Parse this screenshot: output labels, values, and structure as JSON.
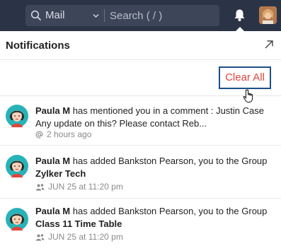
{
  "topbar": {
    "search_scope": "Mail",
    "search_placeholder": "Search ( / )"
  },
  "panel": {
    "title": "Notifications",
    "clear_all_label": "Clear All"
  },
  "notifications": [
    {
      "actor": "Paula M",
      "text": "has mentioned you in a comment : Justin Case Any update on this? Please contact Reb...",
      "bold_tail": "",
      "meta_icon": "at-icon",
      "meta_text": "2 hours ago"
    },
    {
      "actor": "Paula M",
      "text": "has added Bankston Pearson, you to the Group",
      "bold_tail": "Zylker Tech",
      "meta_icon": "group-icon",
      "meta_text": "JUN 25 at 11:20 pm"
    },
    {
      "actor": "Paula M",
      "text": "has added Bankston Pearson, you to the Group",
      "bold_tail": "Class 11 Time Table",
      "meta_icon": "group-icon",
      "meta_text": "JUN 25 at 11:20 pm"
    }
  ],
  "colors": {
    "topbar_bg": "#2b3447",
    "clear_all_text": "#e0463c",
    "clear_all_border": "#1e4f8a"
  }
}
